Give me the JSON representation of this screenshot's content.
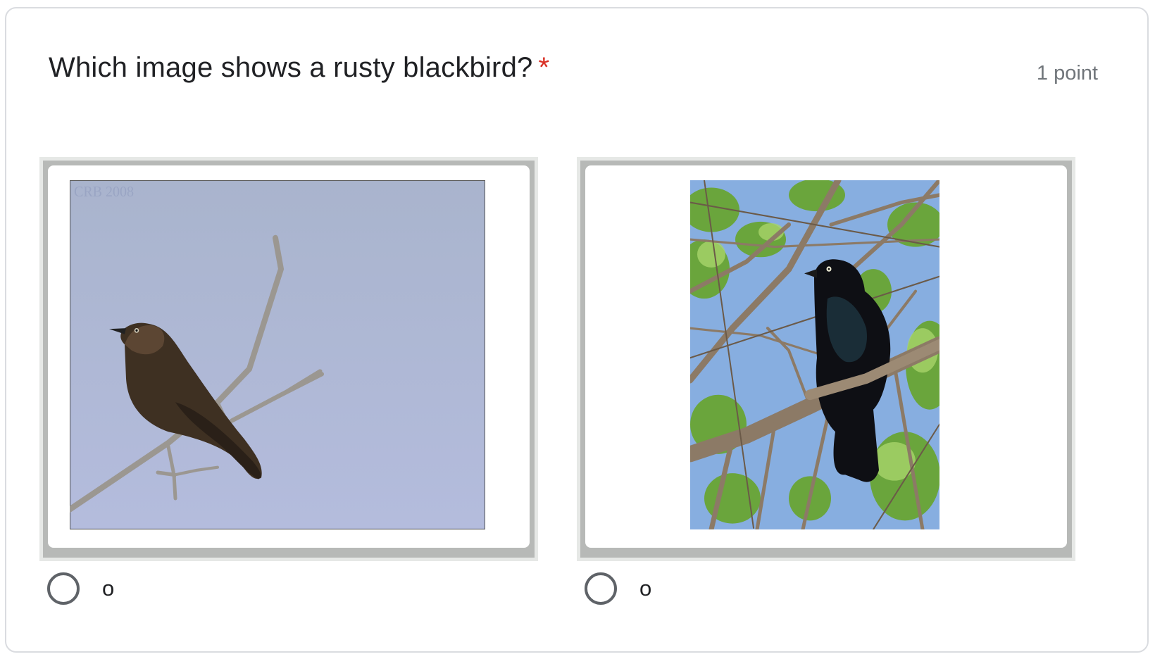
{
  "question": {
    "title": "Which image shows a rusty blackbird?",
    "required_mark": "*",
    "points": "1 point"
  },
  "options": [
    {
      "image_icon": "rusty-blackbird-photo",
      "watermark": "CRB 2008",
      "label": "o",
      "selected": false
    },
    {
      "image_icon": "brewers-blackbird-photo",
      "label": "o",
      "selected": false
    }
  ],
  "colors": {
    "required": "#d93025",
    "text": "#202124",
    "muted": "#70757a",
    "radio": "#5f6368"
  }
}
